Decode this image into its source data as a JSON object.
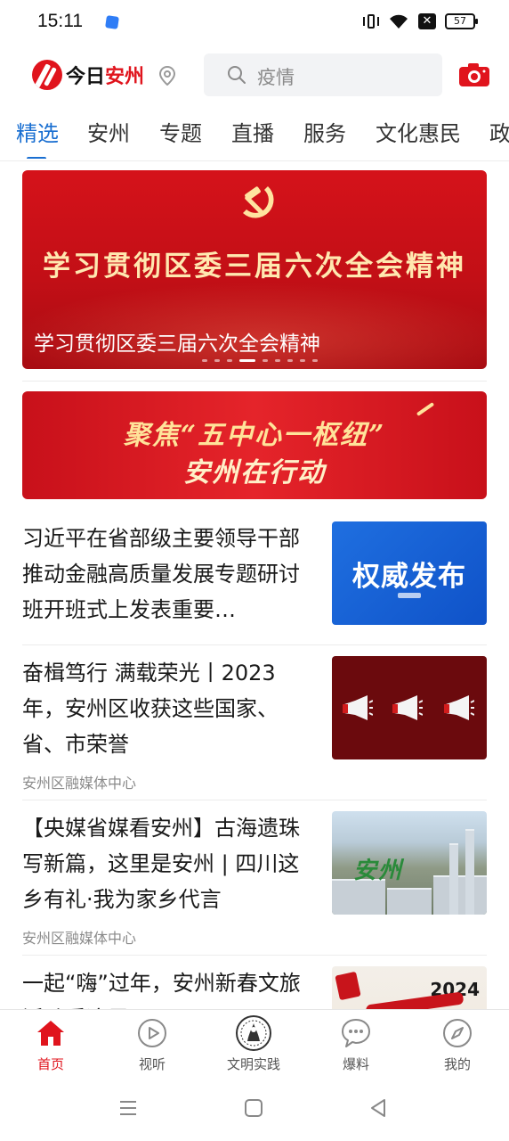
{
  "status_bar": {
    "time": "15:11",
    "battery": "57"
  },
  "header": {
    "logo_part1": "今日",
    "logo_part2": "安州",
    "search_placeholder": "疫情"
  },
  "tabs": [
    "精选",
    "安州",
    "专题",
    "直播",
    "服务",
    "文化惠民",
    "政"
  ],
  "active_tab": 0,
  "banner": {
    "headline": "学习贯彻区委三届六次全会精神",
    "caption": "学习贯彻区委三届六次全会精神",
    "dot_count": 9,
    "active_dot": 3
  },
  "promo": {
    "line1": "聚焦“五中心一枢纽”",
    "line2": "安州在行动"
  },
  "news": [
    {
      "title": "习近平在省部级主要领导干部推动金融高质量发展专题研讨班开班式上发表重要…",
      "source": "",
      "thumb_text": "权威发布"
    },
    {
      "title": "奋楫笃行 满载荣光丨2023年，安州区收获这些国家、省、市荣誉",
      "source": "安州区融媒体中心",
      "thumb_text": ""
    },
    {
      "title": "【央媒省媒看安州】古海遗珠写新篇，这里是安州 | 四川这乡有礼·我为家乡代言",
      "source": "安州区融媒体中心",
      "thumb_text": ""
    },
    {
      "title": "一起“嗨”过年，安州新春文旅活动看这里",
      "source": "",
      "thumb_text": "2024"
    }
  ],
  "bottom_nav": [
    {
      "label": "首页",
      "icon": "home-icon",
      "active": true
    },
    {
      "label": "视听",
      "icon": "play-icon",
      "active": false
    },
    {
      "label": "文明实践",
      "icon": "emblem-icon",
      "active": false
    },
    {
      "label": "爆料",
      "icon": "chat-icon",
      "active": false
    },
    {
      "label": "我的",
      "icon": "compass-icon",
      "active": false
    }
  ],
  "colors": {
    "brand_red": "#e0141d",
    "accent_blue": "#1a6fd1"
  }
}
